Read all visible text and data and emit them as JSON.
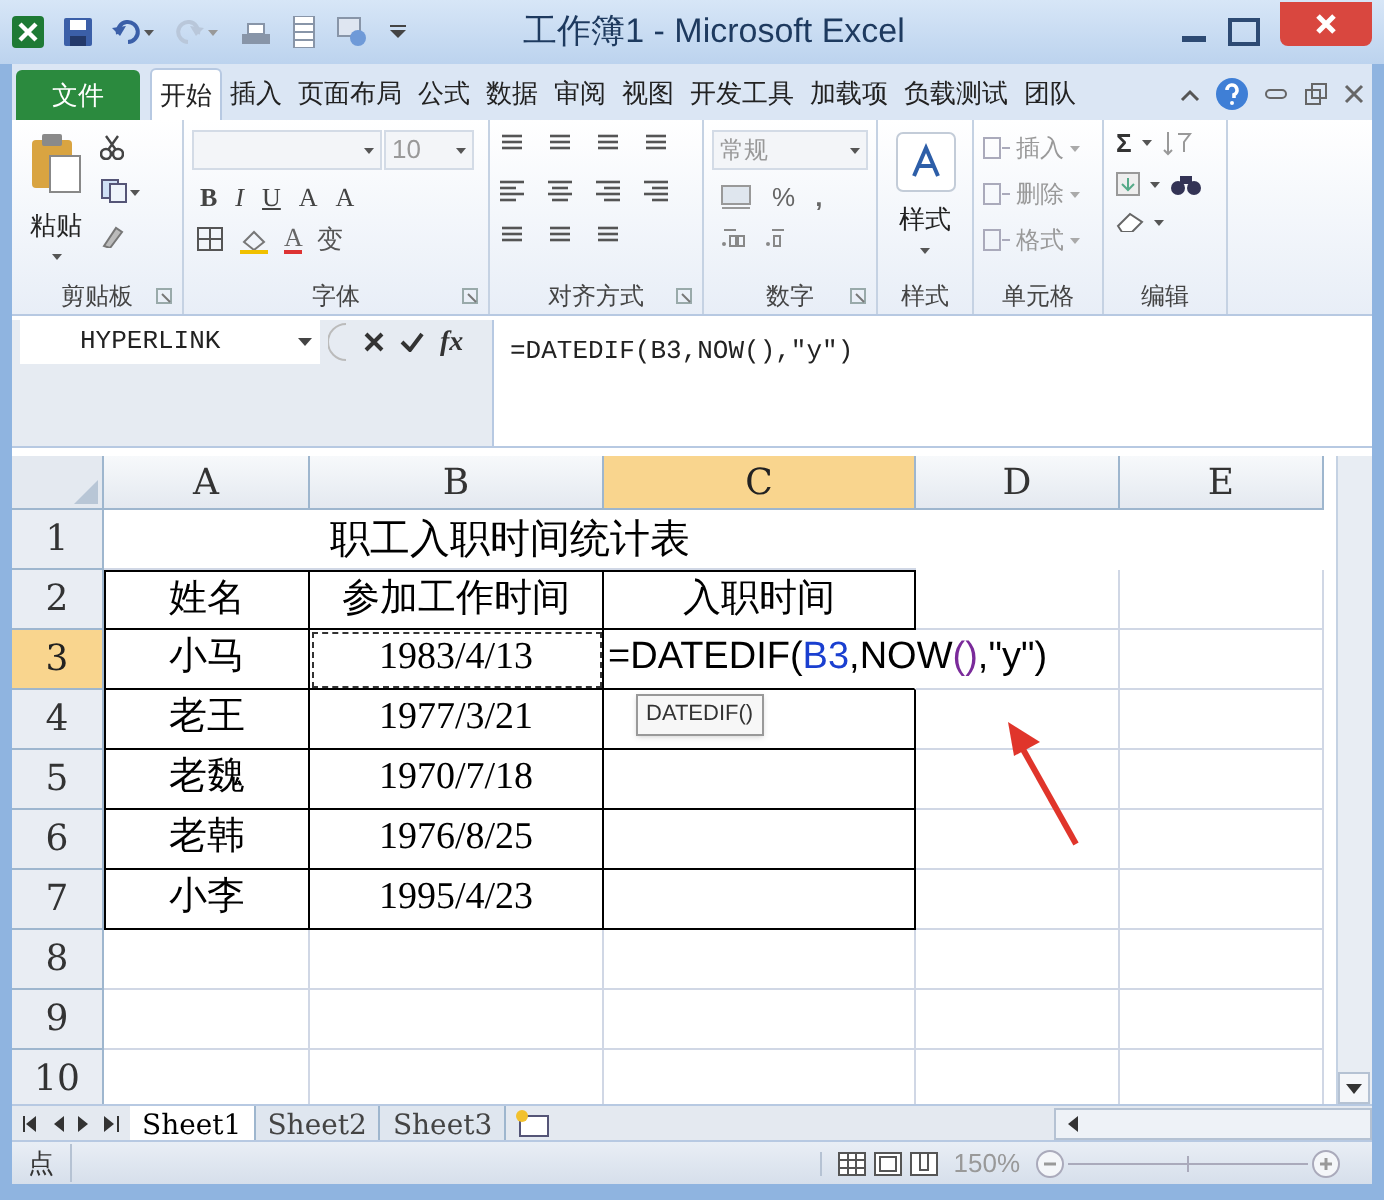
{
  "window": {
    "title": "工作簿1 - Microsoft Excel"
  },
  "ribbon_tabs": [
    {
      "label": "文件",
      "kind": "file",
      "selected": false
    },
    {
      "label": "开始",
      "kind": "tab",
      "selected": true
    },
    {
      "label": "插入",
      "kind": "tab",
      "selected": false
    },
    {
      "label": "页面布局",
      "kind": "tab",
      "selected": false
    },
    {
      "label": "公式",
      "kind": "tab",
      "selected": false
    },
    {
      "label": "数据",
      "kind": "tab",
      "selected": false
    },
    {
      "label": "审阅",
      "kind": "tab",
      "selected": false
    },
    {
      "label": "视图",
      "kind": "tab",
      "selected": false
    },
    {
      "label": "开发工具",
      "kind": "tab",
      "selected": false
    },
    {
      "label": "加载项",
      "kind": "tab",
      "selected": false
    },
    {
      "label": "负载测试",
      "kind": "tab",
      "selected": false
    },
    {
      "label": "团队",
      "kind": "tab",
      "selected": false
    }
  ],
  "ribbon": {
    "groups": [
      {
        "kind": "clipboard",
        "label": "剪贴板",
        "paste": "粘贴"
      },
      {
        "kind": "font",
        "label": "字体",
        "font_size": "10",
        "bold": "B",
        "italic": "I",
        "underline": "U",
        "grow": "A",
        "shrink": "A",
        "font_color": "A",
        "phonetic": "变"
      },
      {
        "kind": "alignment",
        "label": "对齐方式"
      },
      {
        "kind": "number",
        "label": "数字",
        "format": "常规",
        "percent": "%",
        "comma": ","
      },
      {
        "kind": "styles",
        "label": "样式",
        "button": "样式"
      },
      {
        "kind": "cells",
        "label": "单元格",
        "items": [
          "插入",
          "删除",
          "格式"
        ]
      },
      {
        "kind": "editing",
        "label": "编辑",
        "sum": "Σ"
      }
    ]
  },
  "formula_bar": {
    "name_box": "HYPERLINK",
    "function_button": "fx",
    "formula": "=DATEDIF(B3,NOW(),\"y\")"
  },
  "sheet": {
    "title": "职工入职时间统计表",
    "columns": [
      {
        "label": "A",
        "selected": false
      },
      {
        "label": "B",
        "selected": false
      },
      {
        "label": "C",
        "selected": true
      },
      {
        "label": "D",
        "selected": false
      },
      {
        "label": "E",
        "selected": false
      }
    ],
    "rows": [
      {
        "header": "1",
        "selected": false,
        "kind": "title",
        "cells": []
      },
      {
        "header": "2",
        "selected": false,
        "kind": "table",
        "cells": [
          "姓名",
          "参加工作时间",
          "入职时间"
        ]
      },
      {
        "header": "3",
        "selected": true,
        "kind": "table",
        "cells": [
          "小马",
          {
            "text": "1983/4/13",
            "referenced": true
          },
          {
            "kind": "editing",
            "parts": [
              {
                "text": "=DATEDIF(",
                "color": "#000000"
              },
              {
                "text": "B3",
                "color": "#1a3fd0"
              },
              {
                "text": ",NOW",
                "color": "#000000"
              },
              {
                "text": "()",
                "color": "#7a2a9a"
              },
              {
                "text": ",\"y\")",
                "color": "#000000"
              }
            ],
            "hint": "DATEDIF()"
          }
        ]
      },
      {
        "header": "4",
        "selected": false,
        "kind": "table",
        "cells": [
          "老王",
          "1977/3/21",
          ""
        ]
      },
      {
        "header": "5",
        "selected": false,
        "kind": "table",
        "cells": [
          "老魏",
          "1970/7/18",
          ""
        ]
      },
      {
        "header": "6",
        "selected": false,
        "kind": "table",
        "cells": [
          "老韩",
          "1976/8/25",
          ""
        ]
      },
      {
        "header": "7",
        "selected": false,
        "kind": "table",
        "cells": [
          "小李",
          "1995/4/23",
          ""
        ]
      },
      {
        "header": "8",
        "selected": false,
        "kind": "empty",
        "cells": []
      },
      {
        "header": "9",
        "selected": false,
        "kind": "empty",
        "cells": []
      },
      {
        "header": "10",
        "selected": false,
        "kind": "empty",
        "cells": []
      }
    ]
  },
  "sheet_tabs": [
    {
      "label": "Sheet1",
      "selected": true
    },
    {
      "label": "Sheet2",
      "selected": false
    },
    {
      "label": "Sheet3",
      "selected": false
    }
  ],
  "status_bar": {
    "mode": "点",
    "zoom": "150%"
  }
}
